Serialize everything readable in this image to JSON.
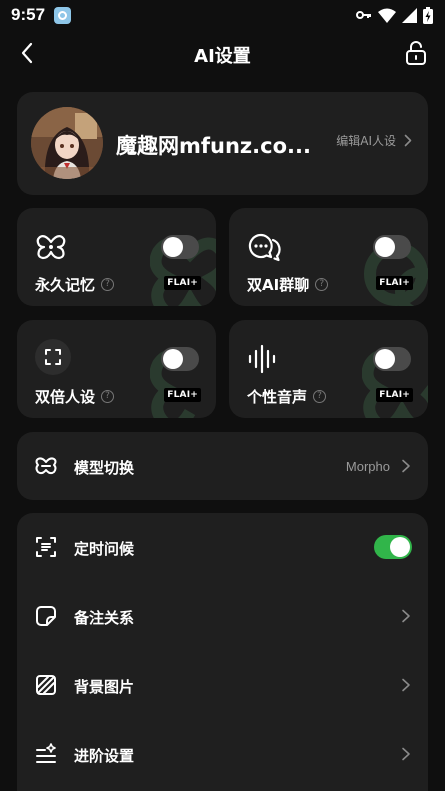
{
  "status_bar": {
    "time": "9:57",
    "icons": [
      "app-notification-icon",
      "key-icon",
      "wifi-icon",
      "signal-icon",
      "battery-charging-icon"
    ]
  },
  "header": {
    "title": "AI设置",
    "back_icon": "chevron-left-icon",
    "lock_icon": "unlock-icon"
  },
  "profile": {
    "name": "魔趣网mfunz.co...",
    "edit_label": "编辑AI人设",
    "avatar": "anime-girl-avatar"
  },
  "features": [
    {
      "label": "永久记忆",
      "icon": "butterfly-loop-icon",
      "badge": "FLAI+",
      "enabled": false
    },
    {
      "label": "双AI群聊",
      "icon": "chat-bubbles-icon",
      "badge": "FLAI+",
      "enabled": false
    },
    {
      "label": "双倍人设",
      "icon": "expand-icon",
      "badge": "FLAI+",
      "enabled": false
    },
    {
      "label": "个性音声",
      "icon": "sound-wave-icon",
      "badge": "FLAI+",
      "enabled": false
    }
  ],
  "help_symbol": "?",
  "model": {
    "label": "模型切换",
    "value": "Morpho",
    "icon": "model-switch-icon"
  },
  "settings": [
    {
      "label": "定时问候",
      "icon": "scheduled-greeting-icon",
      "toggle": true
    },
    {
      "label": "备注关系",
      "icon": "note-icon"
    },
    {
      "label": "背景图片",
      "icon": "background-image-icon"
    },
    {
      "label": "进阶设置",
      "icon": "advanced-settings-icon"
    }
  ],
  "colors": {
    "background": "#0f0f0f",
    "card": "#1f1f1f",
    "toggle_on": "#31b54a",
    "toggle_off": "#4a4a4a",
    "muted_text": "#9a9a9a"
  }
}
